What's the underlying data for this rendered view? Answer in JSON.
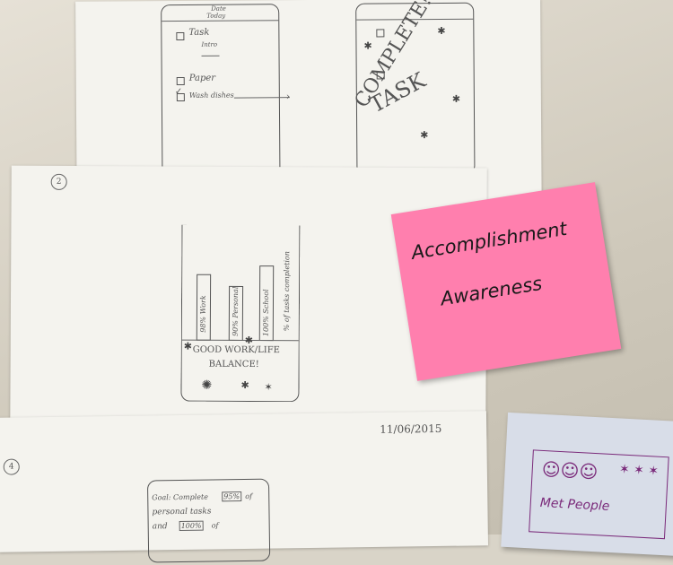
{
  "sketch_top_left": {
    "header_line1": "Date",
    "header_line2": "Today",
    "items": [
      {
        "label": "Task",
        "checked": false
      },
      {
        "label": "Paper",
        "checked": false
      },
      {
        "label": "Wash dishes",
        "checked": true
      }
    ],
    "sub_items": [
      "Intro"
    ]
  },
  "sketch_top_right": {
    "overlay_text_1": "TASK",
    "overlay_text_2": "COMPLETE!"
  },
  "page_2": {
    "number": "2",
    "bars": [
      {
        "label": "98% Work",
        "value": 98
      },
      {
        "label": "90% Personal",
        "value": 90
      },
      {
        "label": "100% School",
        "value": 100
      }
    ],
    "axis_label": "% of tasks completion",
    "message_line1": "GOOD WORK/LIFE",
    "message_line2": "BALANCE!"
  },
  "page_4": {
    "number": "4",
    "date": "11/06/2015",
    "goal_line1": "Goal: Complete",
    "goal_pct1": "95%",
    "goal_of": "of",
    "goal_line2": "personal tasks",
    "goal_and": "and",
    "goal_pct2": "100%"
  },
  "sticky_pink": {
    "line1": "Accomplishment",
    "line2": "Awareness",
    "color": "#ff7fae"
  },
  "sticky_blue": {
    "text": "Met People",
    "color": "#d8dde8"
  }
}
